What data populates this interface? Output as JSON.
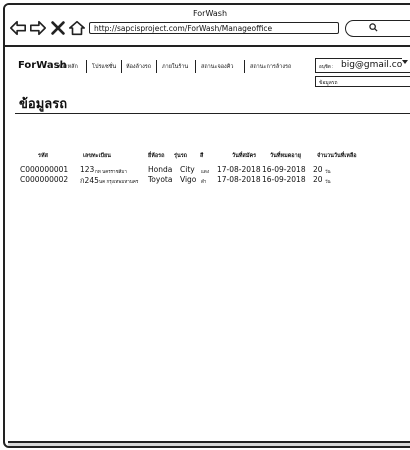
{
  "window": {
    "title": "ForWash"
  },
  "toolbar": {
    "url": "http://sapcisproject.com/ForWash/Manageoffice"
  },
  "menubar": {
    "brand": "ForWash",
    "items": [
      {
        "label": "หน้าหลัก"
      },
      {
        "label": "โปรแซชั่น"
      },
      {
        "label": "ห้องล้างรถ"
      },
      {
        "label": "ภายในร้าน"
      },
      {
        "label": "สถานะจองคิว"
      },
      {
        "label": "สถานะการล้างรถ"
      }
    ],
    "user": {
      "label": "อนุชิต :",
      "email": "big@gmail.com"
    },
    "dropdown_item": "ข้อมูลรถ"
  },
  "main": {
    "title": "ข้อมูลรถ",
    "table": {
      "headers": [
        "รหัส",
        "เลขทะเบียน",
        "ยี่ห้อรถ",
        "รุ่นรถ",
        "สี",
        "วันที่สมัคร",
        "วันที่หมดอายุ",
        "จำนวนวันที่เหลือ"
      ],
      "rows": [
        {
          "id": "C000000001",
          "plate_num": "123",
          "plate_prov": "กท นครราชสีมา",
          "brand": "Honda",
          "model": "City",
          "color": "แดง",
          "start": "17-08-2018",
          "end": "16-09-2018",
          "days": "20",
          "days_unit": "วัน"
        },
        {
          "id": "C000000002",
          "plate_num": "ก245",
          "plate_prov": "นค กรุงเทพมหานคร",
          "brand": "Toyota",
          "model": "Vigo",
          "color": "ดำ",
          "start": "17-08-2018",
          "end": "16-09-2018",
          "days": "20",
          "days_unit": "วัน"
        }
      ]
    }
  }
}
